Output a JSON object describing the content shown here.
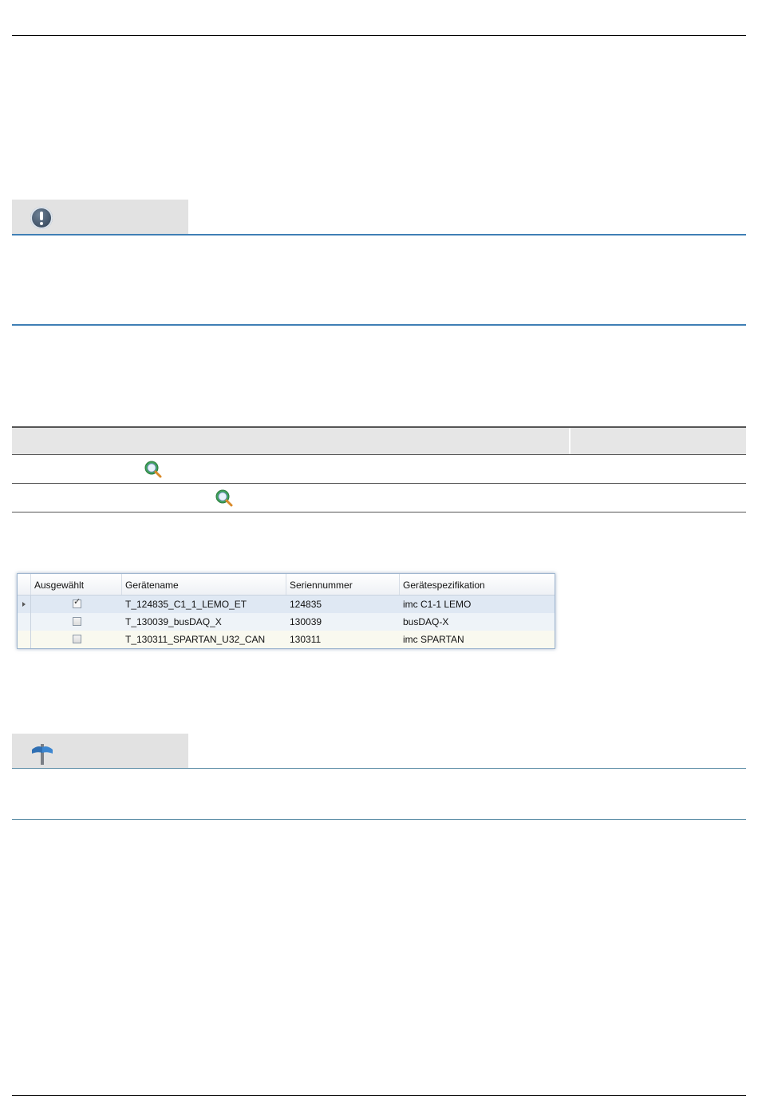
{
  "device_grid": {
    "columns": [
      "Ausgewählt",
      "Gerätename",
      "Seriennummer",
      "Gerätespezifikation"
    ],
    "rows": [
      {
        "selected": true,
        "name": "T_124835_C1_1_LEMO_ET",
        "serial": "124835",
        "spec": "imc C1-1 LEMO"
      },
      {
        "selected": false,
        "name": "T_130039_busDAQ_X",
        "serial": "130039",
        "spec": "busDAQ-X"
      },
      {
        "selected": false,
        "name": "T_130311_SPARTAN_U32_CAN",
        "serial": "130311",
        "spec": "imc SPARTAN"
      }
    ]
  },
  "icons": {
    "warning": "exclamation-circle-icon",
    "tip": "signpost-icon",
    "search": "magnifier-icon"
  },
  "colors": {
    "callout_rule": "#3f7fb5",
    "callout_head_bg": "#e2e2e2",
    "row_selected_bg": "#dfe8f3",
    "row_alt_bg": "#f9f9ef"
  }
}
